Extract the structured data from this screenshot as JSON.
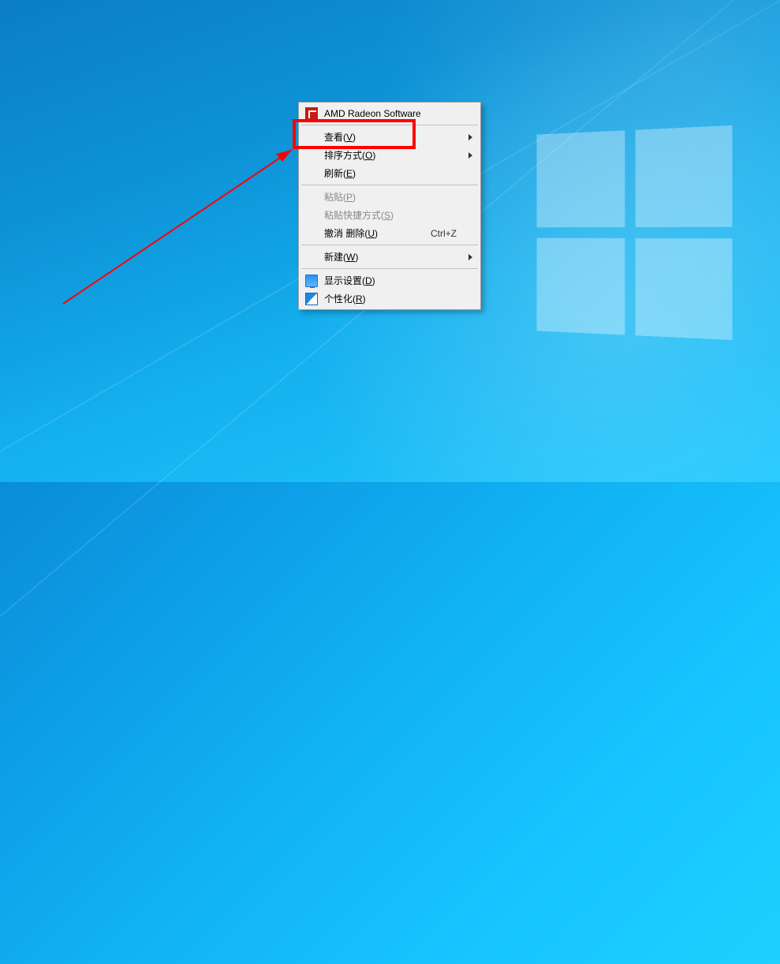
{
  "menu": {
    "amd": "AMD Radeon Software",
    "view": {
      "prefix": "查看(",
      "key": "V",
      "suffix": ")"
    },
    "sort": {
      "prefix": "排序方式(",
      "key": "O",
      "suffix": ")"
    },
    "refresh": {
      "prefix": "刷新(",
      "key": "E",
      "suffix": ")"
    },
    "paste": {
      "prefix": "粘贴(",
      "key": "P",
      "suffix": ")"
    },
    "pasteShortcut": {
      "prefix": "粘贴快捷方式(",
      "key": "S",
      "suffix": ")"
    },
    "undoDelete": {
      "prefix": "撤消 删除(",
      "key": "U",
      "suffix": ")"
    },
    "undoShortcut": "Ctrl+Z",
    "new": {
      "prefix": "新建(",
      "key": "W",
      "suffix": ")"
    },
    "displaySettings": {
      "prefix": "显示设置(",
      "key": "D",
      "suffix": ")"
    },
    "personalize": {
      "prefix": "个性化(",
      "key": "R",
      "suffix": ")"
    }
  },
  "annotation": {
    "highlight_target": "view-menu-item",
    "arrow_color": "#ff0000"
  }
}
